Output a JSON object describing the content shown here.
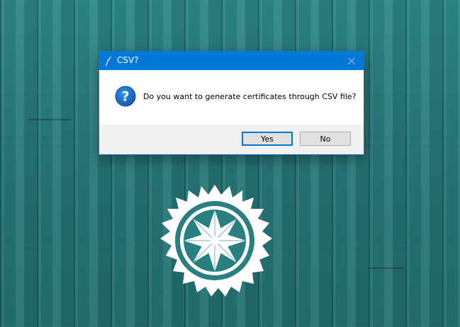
{
  "dialog": {
    "title": "CSV?",
    "message": "Do you want to generate certificates through CSV file?",
    "buttons": {
      "yes_label": "Yes",
      "no_label": "No"
    }
  },
  "colors": {
    "titlebar": "#0078d7",
    "desktop": "#2a7f80",
    "question_icon": "#1565c0",
    "footer": "#f0f0f0"
  },
  "icons": {
    "title": "feather-icon",
    "close": "close-icon",
    "message": "question-icon",
    "wallpaper": "sun-mandala-emblem"
  }
}
